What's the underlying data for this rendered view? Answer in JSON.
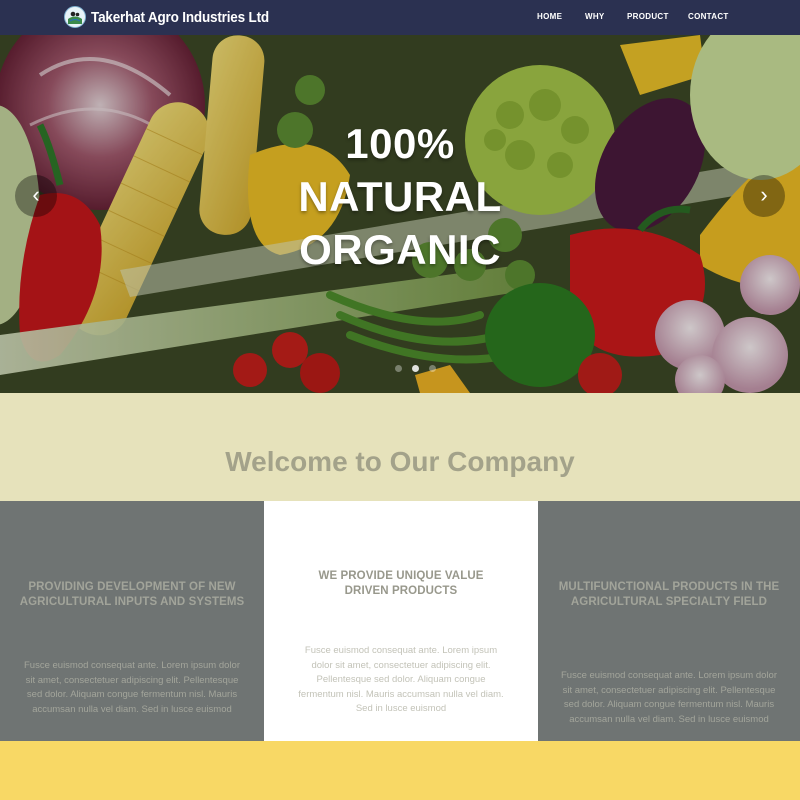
{
  "navbar": {
    "brand": "Takerhat Agro Industries Ltd",
    "items": [
      {
        "label": "HOME"
      },
      {
        "label": "WHY"
      },
      {
        "label": "PRODUCT"
      },
      {
        "label": "CONTACT"
      }
    ]
  },
  "hero": {
    "title_lines": [
      "100%",
      "NATURAL",
      "ORGANIC"
    ],
    "prev_icon": "‹",
    "next_icon": "›",
    "slides_count": 3,
    "active_slide": 2
  },
  "welcome": {
    "title": "Welcome to Our Company"
  },
  "columns": [
    {
      "heading": "PROVIDING DEVELOPMENT OF NEW AGRICULTURAL INPUTS AND SYSTEMS",
      "text": "Fusce euismod consequat ante. Lorem ipsum dolor sit amet, consectetuer adipiscing elit. Pellentesque sed dolor. Aliquam congue fermentum nisl. Mauris accumsan nulla vel diam. Sed in lusce euismod"
    },
    {
      "heading": "WE PROVIDE UNIQUE VALUE DRIVEN PRODUCTS",
      "text": "Fusce euismod consequat ante. Lorem ipsum dolor sit amet, consectetuer adipiscing elit. Pellentesque sed dolor. Aliquam congue fermentum nisl. Mauris accumsan nulla vel diam. Sed in lusce euismod"
    },
    {
      "heading": "MULTIFUNCTIONAL PRODUCTS IN THE AGRICULTURAL SPECIALTY FIELD",
      "text": "Fusce euismod consequat ante. Lorem ipsum dolor sit amet, consectetuer adipiscing elit. Pellentesque sed dolor. Aliquam congue fermentum nisl. Mauris accumsan nulla vel diam. Sed in lusce euismod"
    }
  ],
  "colors": {
    "navbar": "#2b3151",
    "welcome_bg": "#e6e2bb",
    "column_grey": "#6f7473",
    "footer_bar": "#f8d865"
  }
}
